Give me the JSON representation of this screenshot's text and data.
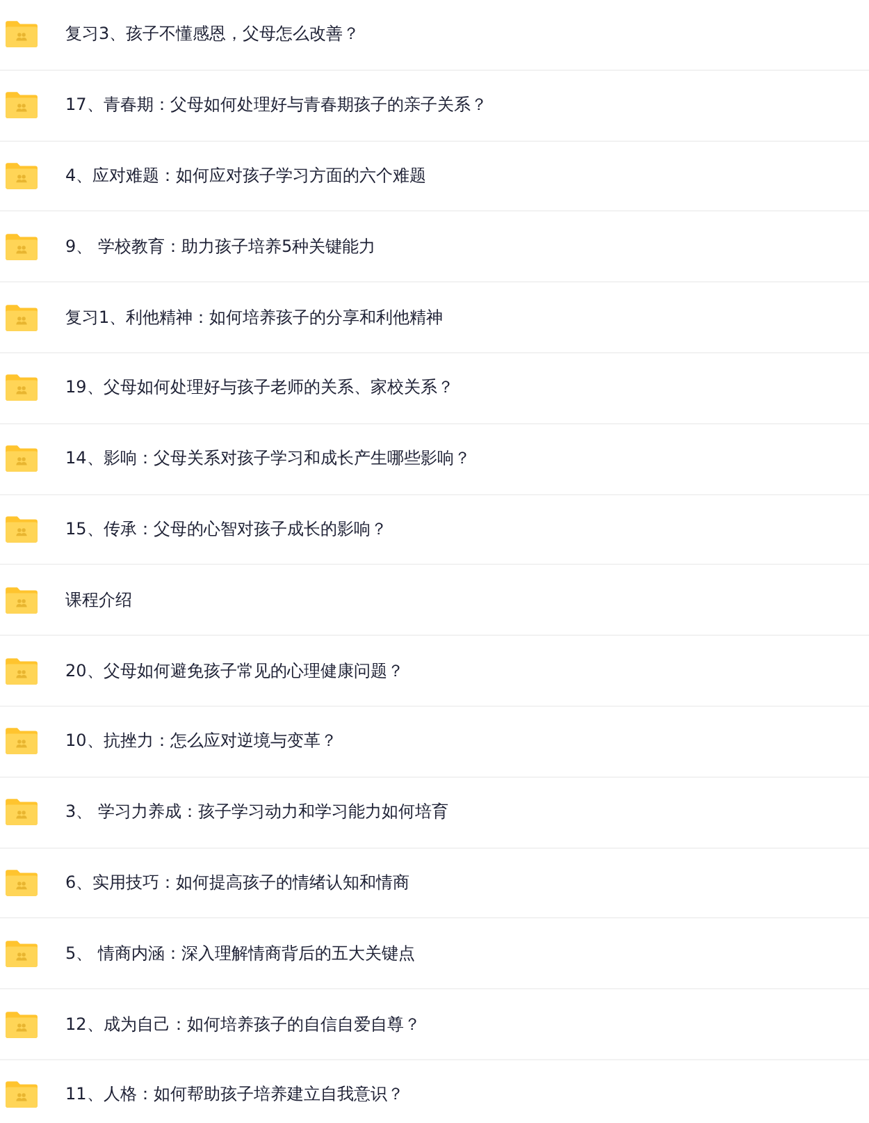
{
  "files": [
    {
      "name": "复习3、孩子不懂感恩，父母怎么改善？"
    },
    {
      "name": "17、青春期：父母如何处理好与青春期孩子的亲子关系？"
    },
    {
      "name": "4、应对难题：如何应对孩子学习方面的六个难题"
    },
    {
      "name": "9、 学校教育：助力孩子培养5种关键能力"
    },
    {
      "name": "复习1、利他精神：如何培养孩子的分享和利他精神"
    },
    {
      "name": "19、父母如何处理好与孩子老师的关系、家校关系？"
    },
    {
      "name": "14、影响：父母关系对孩子学习和成长产生哪些影响？"
    },
    {
      "name": "15、传承：父母的心智对孩子成长的影响？"
    },
    {
      "name": "课程介绍"
    },
    {
      "name": "20、父母如何避免孩子常见的心理健康问题？"
    },
    {
      "name": "10、抗挫力：怎么应对逆境与变革？"
    },
    {
      "name": "3、 学习力养成：孩子学习动力和学习能力如何培育"
    },
    {
      "name": "6、实用技巧：如何提高孩子的情绪认知和情商"
    },
    {
      "name": "5、 情商内涵：深入理解情商背后的五大关键点"
    },
    {
      "name": "12、成为自己：如何培养孩子的自信自爱自尊？"
    },
    {
      "name": "11、人格：如何帮助孩子培养建立自我意识？"
    }
  ]
}
